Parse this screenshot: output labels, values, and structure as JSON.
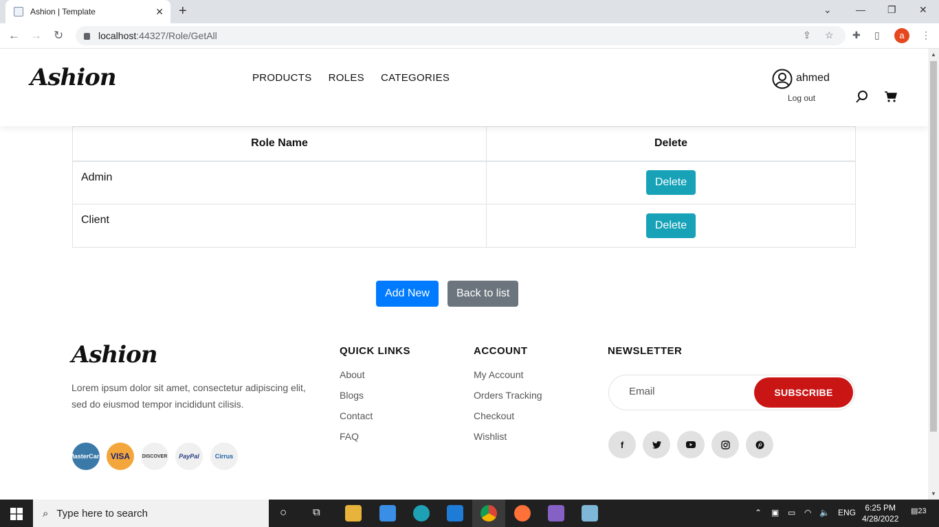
{
  "browser": {
    "tab_title": "Ashion | Template",
    "url_host": "localhost",
    "url_rest": ":44327/Role/GetAll",
    "profile_initial": "a"
  },
  "header": {
    "logo": "Ashion",
    "nav": [
      "PRODUCTS",
      "ROLES",
      "CATEGORIES"
    ],
    "user_name": "ahmed",
    "logout": "Log out"
  },
  "table": {
    "headers": [
      "Role Name",
      "Delete"
    ],
    "rows": [
      {
        "name": "Admin",
        "action": "Delete"
      },
      {
        "name": "Client",
        "action": "Delete"
      }
    ]
  },
  "actions": {
    "add_new": "Add New",
    "back": "Back to list"
  },
  "footer": {
    "logo": "Ashion",
    "text": "Lorem ipsum dolor sit amet, consectetur adipiscing elit, sed do eiusmod tempor incididunt cilisis.",
    "payments": [
      "MasterCard",
      "VISA",
      "DISCOVER",
      "PayPal",
      "Cirrus"
    ],
    "quick_links_title": "QUICK LINKS",
    "quick_links": [
      "About",
      "Blogs",
      "Contact",
      "FAQ"
    ],
    "account_title": "ACCOUNT",
    "account_links": [
      "My Account",
      "Orders Tracking",
      "Checkout",
      "Wishlist"
    ],
    "newsletter_title": "NEWSLETTER",
    "email_placeholder": "Email",
    "subscribe": "SUBSCRIBE",
    "social": [
      "f",
      "t",
      "yt",
      "ig",
      "p"
    ]
  },
  "taskbar": {
    "search_placeholder": "Type here to search",
    "lang": "ENG",
    "time": "6:25 PM",
    "date": "4/28/2022",
    "notifications": "23"
  },
  "colors": {
    "delete_btn": "#17a2b8",
    "add_btn": "#007bff",
    "back_btn": "#6c757d",
    "subscribe_btn": "#ca1515"
  }
}
